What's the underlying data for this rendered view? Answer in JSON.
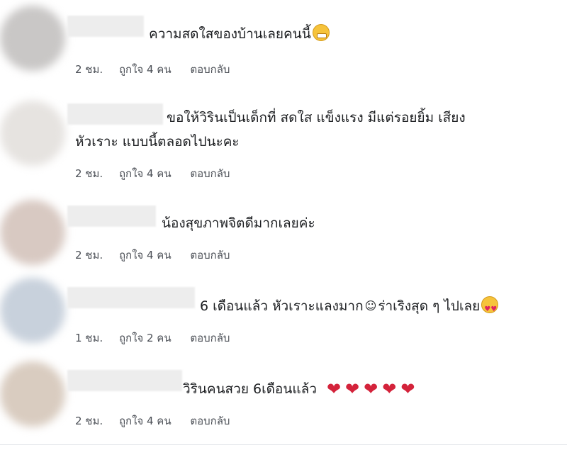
{
  "colors": {
    "text": "#1c1e21",
    "meta": "#4b4f56",
    "heart": "#d4233b"
  },
  "comments": [
    {
      "text": "ความสดใสของบ้านเลยคนนี้",
      "emoji": "grinning-face-emoji",
      "time": "2 ชม.",
      "likes": "ถูกใจ 4 คน",
      "reply": "ตอบกลับ"
    },
    {
      "text_line1": "ขอให้วิรินเป็นเด็กที่ สดใส แข็งแรง มีแต่รอยยิ้ม เสียง",
      "text_line2": "หัวเราะ แบบนี้ตลอดไปนะคะ",
      "time": "2 ชม.",
      "likes": "ถูกใจ 4 คน",
      "reply": "ตอบกลับ"
    },
    {
      "text": "น้องสุขภาพจิตดีมากเลยค่ะ",
      "time": "2 ชม.",
      "likes": "ถูกใจ 4 คน",
      "reply": "ตอบกลับ"
    },
    {
      "text_part1": "6 เดือนแล้ว หัวเราะแลงมาก",
      "smile": "☺",
      "text_part2": "ร่าเริงสุด ๆ ไปเลย",
      "emoji": "smiling-face-with-hearts-emoji",
      "time": "1 ชม.",
      "likes": "ถูกใจ 2 คน",
      "reply": "ตอบกลับ"
    },
    {
      "text": "วิรินคนสวย 6เดือนแล้ว",
      "hearts": [
        "❤",
        "❤",
        "❤",
        "❤",
        "❤"
      ],
      "time": "2 ชม.",
      "likes": "ถูกใจ 4 คน",
      "reply": "ตอบกลับ"
    }
  ]
}
